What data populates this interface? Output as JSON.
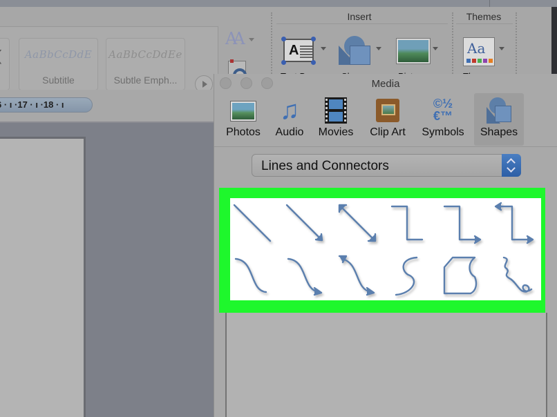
{
  "ribbon": {
    "styles": [
      {
        "sample": "AaBbCcDdE",
        "name": "Subtitle"
      },
      {
        "sample": "AaBbCcDdEe",
        "name": "Subtle Emph..."
      }
    ],
    "font_size_glyph": "AA",
    "groups": {
      "insert": {
        "label": "Insert",
        "buttons": [
          {
            "name": "Text Box",
            "icon": "text-box-icon"
          },
          {
            "name": "Shape",
            "icon": "shape-icon"
          },
          {
            "name": "Picture",
            "icon": "picture-icon"
          }
        ]
      },
      "themes": {
        "label": "Themes",
        "buttons": [
          {
            "name": "Themes",
            "icon": "theme-icon",
            "glyph": "Aa"
          }
        ]
      }
    }
  },
  "ruler": {
    "text": "6 · ı ·17 · ı ·18 · ı"
  },
  "media_panel": {
    "title": "Media",
    "tabs": [
      {
        "label": "Photos",
        "icon": "photos-icon",
        "active": false
      },
      {
        "label": "Audio",
        "icon": "audio-icon",
        "glyph": "♫",
        "active": false
      },
      {
        "label": "Movies",
        "icon": "movies-icon",
        "active": false
      },
      {
        "label": "Clip Art",
        "icon": "clip-art-icon",
        "active": false
      },
      {
        "label": "Symbols",
        "icon": "symbols-icon",
        "glyph_top": "©½",
        "glyph_bottom": "€™",
        "active": false
      },
      {
        "label": "Shapes",
        "icon": "shapes-icon",
        "active": true
      }
    ],
    "category_select": {
      "value": "Lines and Connectors"
    },
    "highlight_color": "#1ef72c",
    "shape_color": "#5b7fae",
    "shapes": [
      {
        "name": "line"
      },
      {
        "name": "arrow"
      },
      {
        "name": "double-arrow"
      },
      {
        "name": "elbow-connector"
      },
      {
        "name": "elbow-arrow-connector"
      },
      {
        "name": "elbow-double-arrow-connector"
      },
      {
        "name": "curved-connector"
      },
      {
        "name": "curved-arrow-connector"
      },
      {
        "name": "curved-double-arrow-connector"
      },
      {
        "name": "curve"
      },
      {
        "name": "freeform"
      },
      {
        "name": "scribble"
      }
    ]
  }
}
